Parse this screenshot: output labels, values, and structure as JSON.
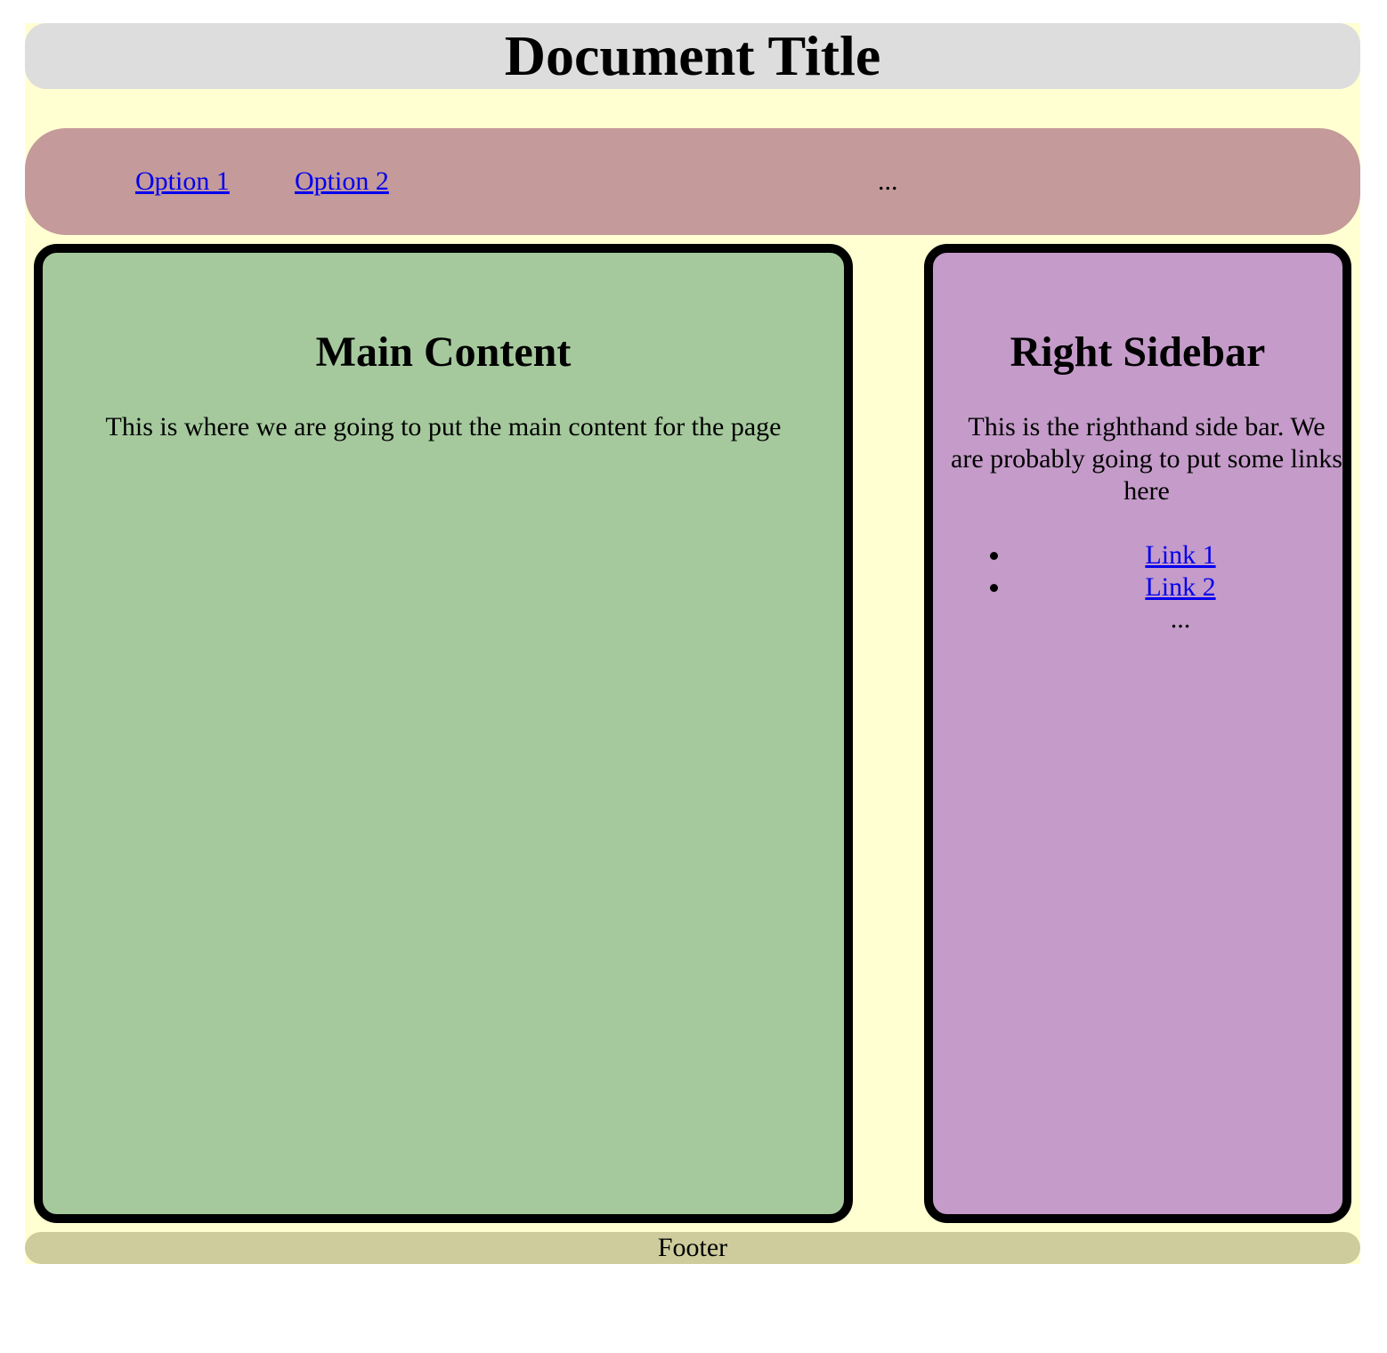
{
  "header": {
    "title": "Document Title"
  },
  "nav": {
    "items": [
      {
        "label": "Option 1"
      },
      {
        "label": "Option 2"
      }
    ],
    "more": "..."
  },
  "main": {
    "heading": "Main Content",
    "body": "This is where we are going to put the main content for the page"
  },
  "sidebar": {
    "heading": "Right Sidebar",
    "body": "This is the righthand side bar. We are probably going to put some links here",
    "links": [
      {
        "label": "Link 1"
      },
      {
        "label": "Link 2"
      }
    ],
    "more": "..."
  },
  "footer": {
    "text": "Footer"
  },
  "colors": {
    "page_background": "#ffffd2",
    "header_background": "#dddddd",
    "nav_background": "#c49a9a",
    "main_background": "#a5c99d",
    "sidebar_background": "#c49bc9",
    "footer_background": "#cecc9d",
    "link": "#0000ee"
  }
}
